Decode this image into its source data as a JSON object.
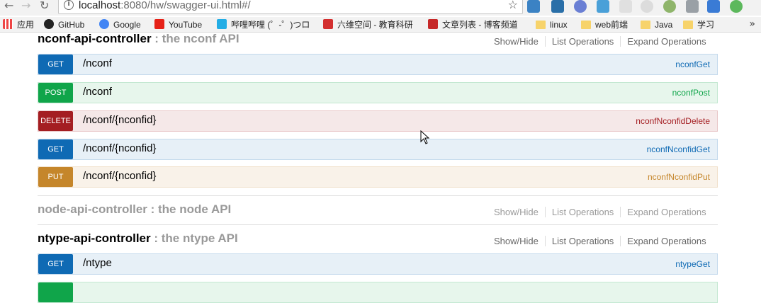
{
  "browser": {
    "url_host": "localhost",
    "url_rest": ":8080/hw/swagger-ui.html#/",
    "bookmarks": [
      "应用",
      "GitHub",
      "Google",
      "YouTube",
      "哔哩哔哩 (゜-゜)つロ",
      "六维空间 - 教育科研",
      "文章列表 - 博客频道",
      "linux",
      "web前端",
      "Java",
      "学习"
    ],
    "more_label": "»"
  },
  "resources": [
    {
      "name": "nconf-api-controller",
      "sep": " : ",
      "description": "the nconf API",
      "links": [
        "Show/Hide",
        "List Operations",
        "Expand Operations"
      ],
      "operations": [
        {
          "method": "GET",
          "path": "/nconf",
          "id": "nconfGet"
        },
        {
          "method": "POST",
          "path": "/nconf",
          "id": "nconfPost"
        },
        {
          "method": "DELETE",
          "path": "/nconf/{nconfid}",
          "id": "nconfNconfidDelete"
        },
        {
          "method": "GET",
          "path": "/nconf/{nconfid}",
          "id": "nconfNconfidGet"
        },
        {
          "method": "PUT",
          "path": "/nconf/{nconfid}",
          "id": "nconfNconfidPut"
        }
      ]
    },
    {
      "name": "node-api-controller",
      "sep": " : ",
      "description": "the node API",
      "links": [
        "Show/Hide",
        "List Operations",
        "Expand Operations"
      ],
      "operations": []
    },
    {
      "name": "ntype-api-controller",
      "sep": " : ",
      "description": "the ntype API",
      "links": [
        "Show/Hide",
        "List Operations",
        "Expand Operations"
      ],
      "operations": [
        {
          "method": "GET",
          "path": "/ntype",
          "id": "ntypeGet"
        }
      ]
    }
  ]
}
